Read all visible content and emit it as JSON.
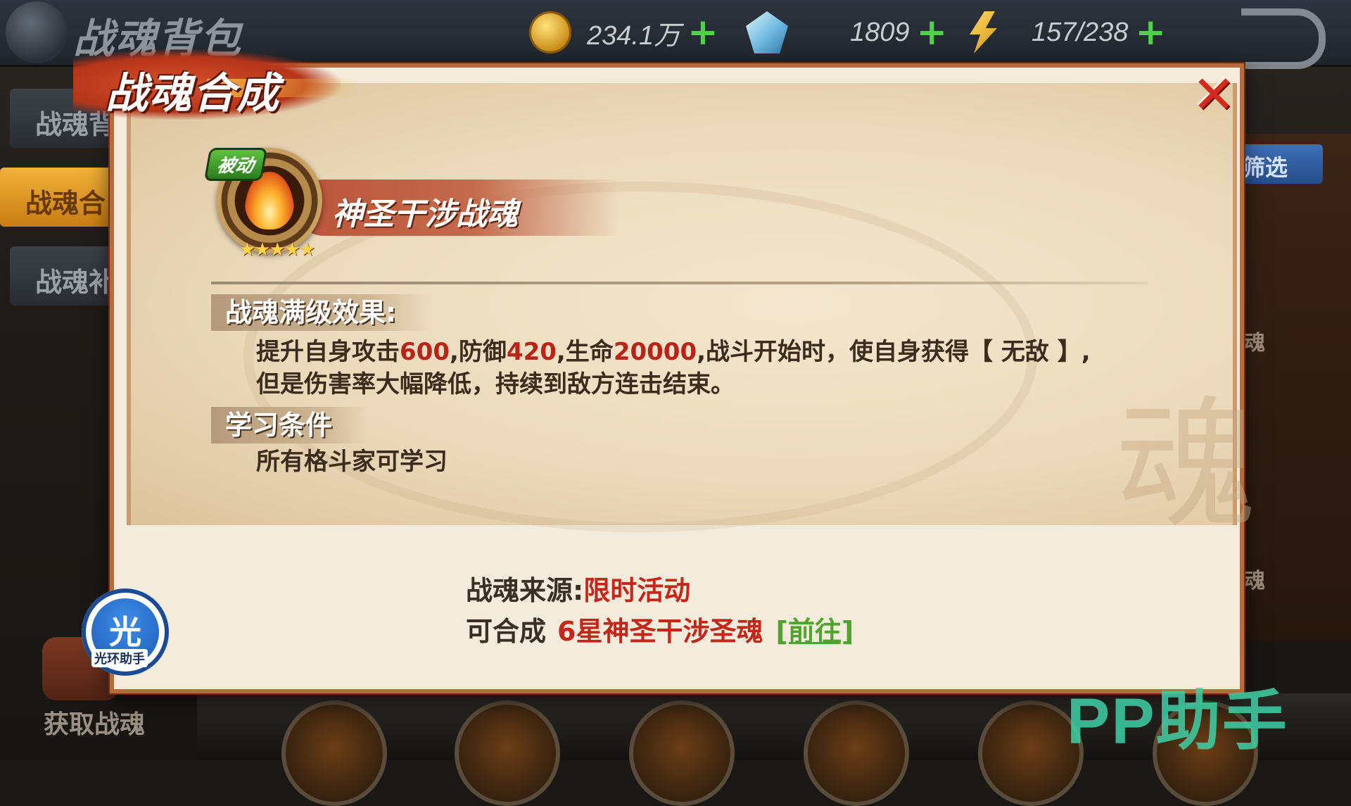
{
  "screen": {
    "title": "战魂背包",
    "resources": [
      {
        "icon": "gold-coin-icon",
        "value": "234.1万"
      },
      {
        "icon": "diamond-icon",
        "value": "1809"
      },
      {
        "icon": "energy-bolt-icon",
        "value": "157/238"
      }
    ],
    "plus_label": "+",
    "side_tabs": [
      "战魂背",
      "战魂合",
      "战魂补"
    ],
    "filter_label": "筛选",
    "right_labels": [
      "魂",
      "魂"
    ],
    "fetch_label": "获取战魂"
  },
  "modal": {
    "title": "战魂合成",
    "close_label": "✕",
    "skill": {
      "tag": "被动",
      "name": "神圣干涉战魂",
      "stars": "★★★★★",
      "star_count": 5
    },
    "effect": {
      "heading": "战魂满级效果:",
      "line1_a": "提升自身攻击",
      "attack": "600",
      "line1_b": ",防御",
      "defense": "420",
      "line1_c": ",生命",
      "hp": "20000",
      "line1_d": ",战斗开始时，使自身获得【 无敌 】,",
      "line2": "但是伤害率大幅降低，持续到敌方连击结束。"
    },
    "learn": {
      "heading": "学习条件",
      "text": "所有格斗家可学习"
    },
    "source_label": "战魂来源:",
    "source_value": "限时活动",
    "synth_label": "可合成",
    "synth_value": "6星神圣干涉圣魂",
    "goto_label": "[前往]"
  },
  "overlays": {
    "badge_char": "光",
    "badge_caption": "光环助手",
    "pp_text": "PP助手"
  },
  "colors": {
    "highlight_red": "#b92318",
    "link_green": "#4ea42d",
    "plus_green": "#4fd14a",
    "title_red": "#c6261a"
  }
}
